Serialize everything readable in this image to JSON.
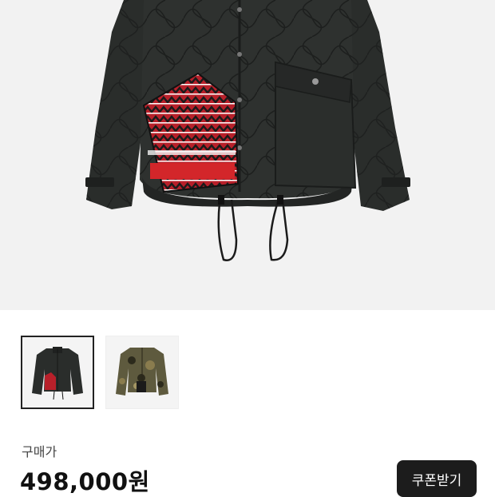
{
  "product": {
    "main_image_icon": "quilted-jacket-with-knit-pocket-image",
    "thumbnails": [
      {
        "icon": "black-quilted-jacket-thumbnail",
        "selected": true
      },
      {
        "icon": "camo-jacket-thumbnail",
        "selected": false
      }
    ]
  },
  "price": {
    "label": "구매가",
    "value": "498,000원"
  },
  "actions": {
    "coupon_label": "쿠폰받기"
  },
  "colors": {
    "jacket": "#2a2d2b",
    "knit_red": "#c0282a",
    "button_bg": "#1c1c1c"
  }
}
